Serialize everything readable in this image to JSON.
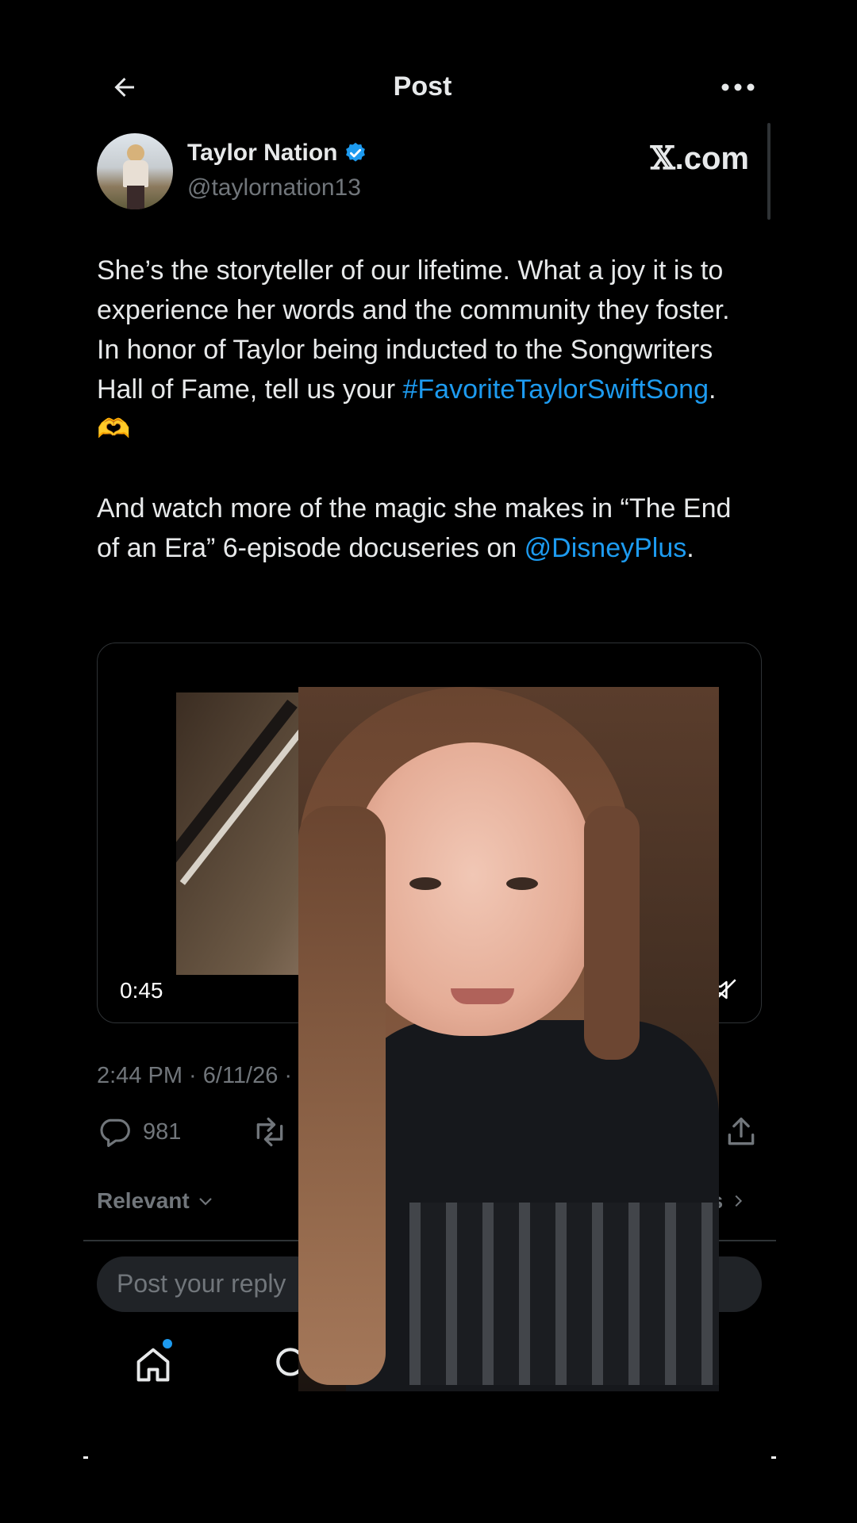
{
  "header": {
    "title": "Post",
    "back_icon": "arrow-left-icon",
    "more_icon": "more-horizontal-icon"
  },
  "author": {
    "name": "Taylor Nation",
    "handle": "@taylornation13",
    "verified": true,
    "verified_color": "#1d9bf0"
  },
  "watermark": {
    "x": "𝕏",
    "domain": ".com"
  },
  "post": {
    "line1": "She’s the storyteller of our lifetime. What a joy it is to experience her words and the community they foster. In honor of Taylor being inducted to the Songwriters Hall of Fame, tell us your ",
    "hashtag": "#FavoriteTaylorSwiftSong",
    "line1_end": ". 🫶",
    "line2": "And watch more of the magic she makes in “The End of an Era” 6-episode docuseries on ",
    "mention": "@DisneyPlus",
    "line2_end": "."
  },
  "video": {
    "duration": "0:45",
    "muted": true
  },
  "meta": {
    "timestamp": "2:44 PM · 6/11/26 ·"
  },
  "actions": {
    "replies": "981"
  },
  "replies_filter": {
    "label": "Relevant",
    "right_label": "es"
  },
  "reply_box": {
    "placeholder": "Post your reply"
  },
  "colors": {
    "background": "#000000",
    "text": "#e7e9ea",
    "muted": "#71767b",
    "link": "#1d9bf0",
    "border": "#2f3336"
  }
}
